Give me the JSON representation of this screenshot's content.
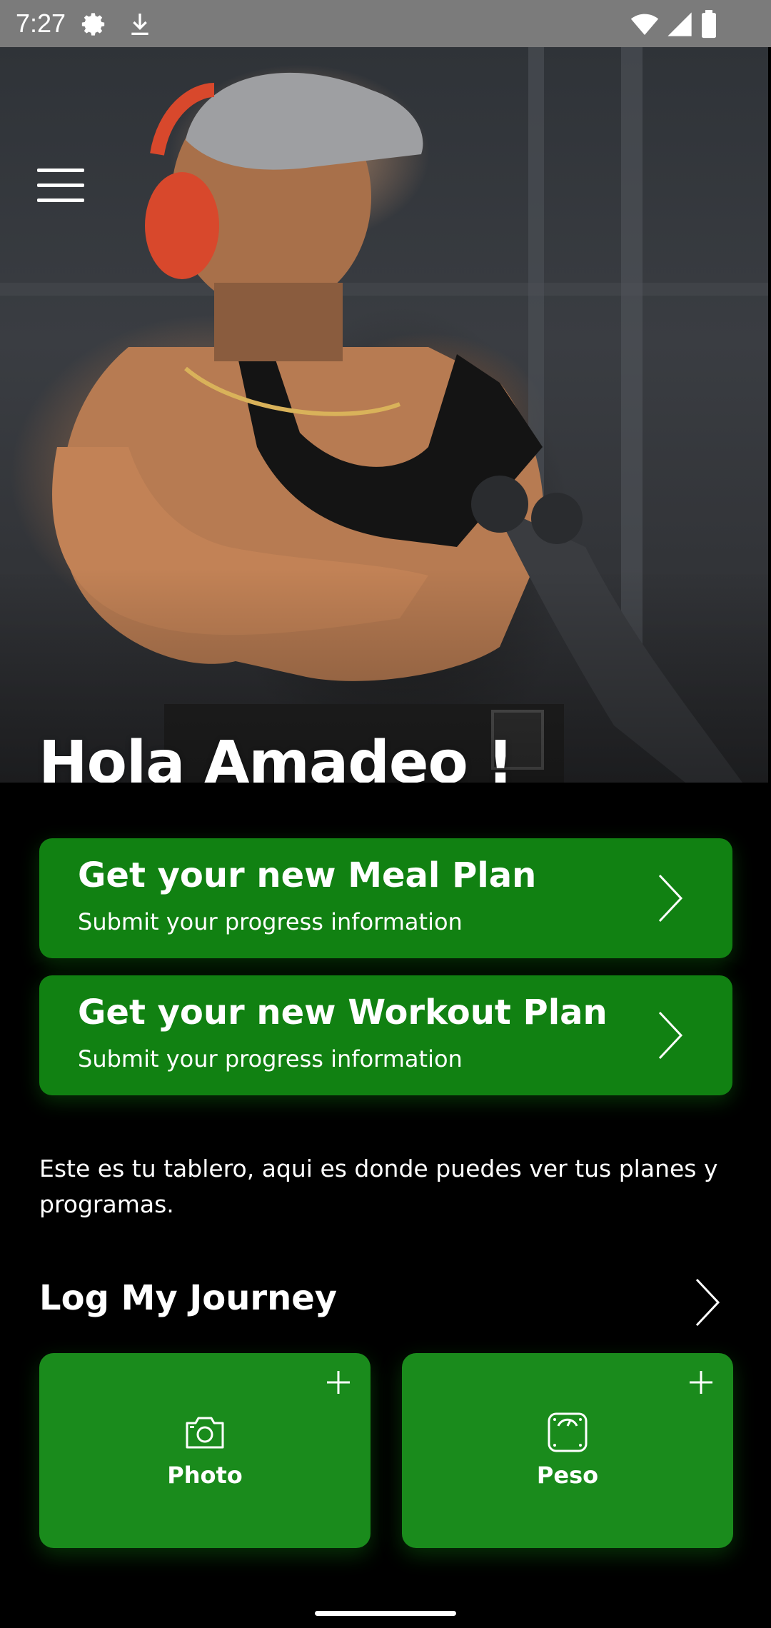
{
  "status_bar": {
    "time": "7:27",
    "icons": [
      "settings-icon",
      "download-icon",
      "wifi-icon",
      "signal-icon",
      "battery-icon"
    ]
  },
  "hero": {
    "greeting": "Hola Amadeo !",
    "menu_icon": "hamburger-menu-icon"
  },
  "plans": [
    {
      "title": "Get your new Meal Plan",
      "subtitle": "Submit your progress information"
    },
    {
      "title": "Get your new Workout Plan",
      "subtitle": "Submit your progress information"
    }
  ],
  "description": "Este es tu tablero, aqui es donde puedes ver tus planes y programas.",
  "journey": {
    "title": "Log My Journey",
    "tiles": [
      {
        "label": "Photo",
        "icon": "camera-icon"
      },
      {
        "label": "Peso",
        "icon": "scale-icon"
      }
    ]
  },
  "colors": {
    "plan_card": "#118112",
    "tile": "#1a8b1c",
    "background": "#000000",
    "status_bar": "#7b7b7b"
  }
}
